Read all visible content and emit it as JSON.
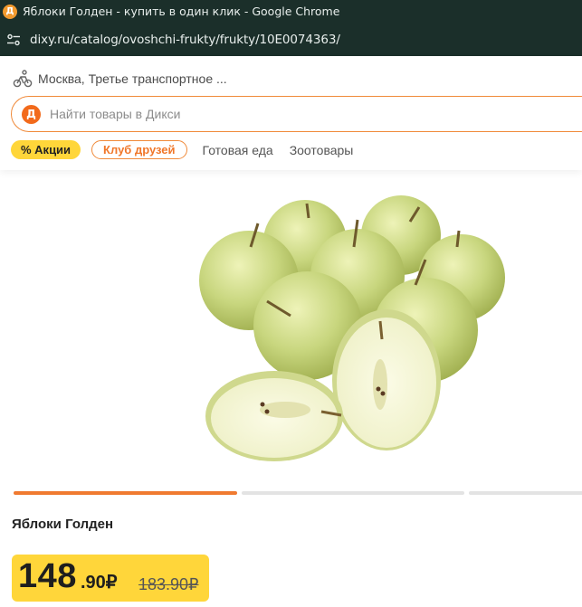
{
  "window": {
    "title": "Яблоки Голден - купить в один клик - Google Chrome",
    "favicon_letter": "Д",
    "url": "dixy.ru/catalog/ovoshchi-frukty/frukty/10E0074363/"
  },
  "header": {
    "location": "Москва, Третье транспортное ...",
    "search": {
      "logo_letter": "Д",
      "placeholder": "Найти товары в Дикси"
    },
    "categories": [
      {
        "label": "% Акции"
      },
      {
        "label": "Клуб друзей"
      },
      {
        "label": "Готовая еда"
      },
      {
        "label": "Зоотовары"
      }
    ]
  },
  "gallery": {
    "image": "apples-photo",
    "current_slide": 1,
    "slide_count": 3
  },
  "product": {
    "name": "Яблоки Голден",
    "price_int": "148",
    "price_dec": ".90₽",
    "old_price": "183.90₽"
  },
  "colors": {
    "chrome_bg": "#1b2f2a",
    "brand_orange": "#f07a30",
    "brand_yellow": "#ffd63a"
  }
}
